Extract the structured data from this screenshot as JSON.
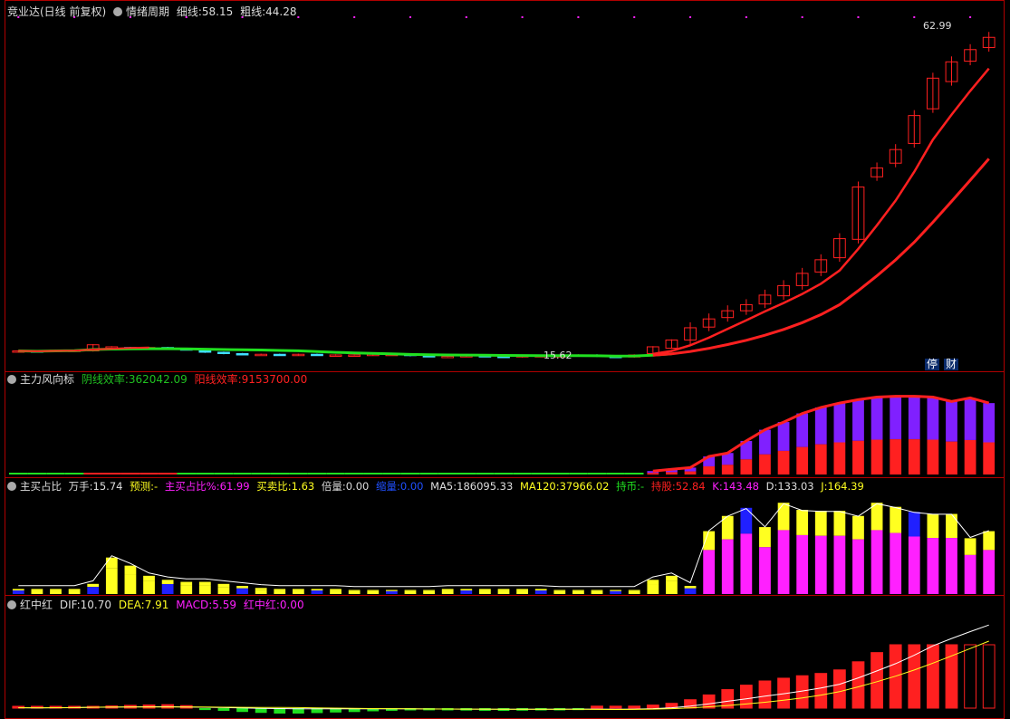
{
  "header": {
    "title": "竞业达(日线 前复权)",
    "indicator_name": "情绪周期",
    "thin_label": "细线:",
    "thin_value": "58.15",
    "thick_label": "粗线:",
    "thick_value": "44.28"
  },
  "price_panel": {
    "high_label": "62.99",
    "low_label": "15.62",
    "badge_1": "停",
    "badge_2": "财"
  },
  "panel2": {
    "name": "主力风向标",
    "yin_label": "阴线效率:",
    "yin_value": "362042.09",
    "yang_label": "阳线效率:",
    "yang_value": "9153700.00"
  },
  "panel3": {
    "name": "主买占比",
    "wanshou_label": "万手:",
    "wanshou_value": "15.74",
    "yuce_label": "预测:",
    "yuce_value": "-",
    "zmzb_label": "主买占比%:",
    "zmzb_value": "61.99",
    "mmb_label": "买卖比:",
    "mmb_value": "1.63",
    "beiliang_label": "倍量:",
    "beiliang_value": "0.00",
    "suoliang_label": "缩量:",
    "suoliang_value": "0.00",
    "ma5_label": "MA5:",
    "ma5_value": "186095.33",
    "ma120_label": "MA120:",
    "ma120_value": "37966.02",
    "chibi_label": "持币:",
    "chibi_value": "-",
    "chigu_label": "持股:",
    "chigu_value": "52.84",
    "k_label": "K:",
    "k_value": "143.48",
    "d_label": "D:",
    "d_value": "133.03",
    "j_label": "J:",
    "j_value": "164.39"
  },
  "panel4": {
    "name": "红中红",
    "dif_label": "DIF:",
    "dif_value": "10.70",
    "dea_label": "DEA:",
    "dea_value": "7.91",
    "macd_label": "MACD:",
    "macd_value": "5.59",
    "hzh_label": "红中红:",
    "hzh_value": "0.00"
  },
  "colors": {
    "up": "#ff2020",
    "down": "#40e0ff",
    "ma_thin": "#ff2020",
    "ma_green": "#20e020",
    "purple": "#8020ff",
    "magenta": "#ff20ff",
    "yellow": "#ffff20",
    "blue": "#2020ff"
  },
  "chart_data": [
    {
      "type": "candlestick",
      "series": "price",
      "x": [
        1,
        2,
        3,
        4,
        5,
        6,
        7,
        8,
        9,
        10,
        11,
        12,
        13,
        14,
        15,
        16,
        17,
        18,
        19,
        20,
        21,
        22,
        23,
        24,
        25,
        26,
        27,
        28,
        29,
        30,
        31,
        32,
        33,
        34,
        35,
        36,
        37,
        38,
        39,
        40,
        41,
        42,
        43,
        44,
        45,
        46,
        47,
        48,
        49,
        50
      ],
      "open": [
        16.3,
        16.4,
        16.3,
        16.5,
        16.4,
        17.0,
        16.9,
        16.8,
        16.9,
        16.7,
        16.5,
        16.2,
        16.0,
        15.9,
        15.9,
        15.8,
        15.9,
        15.8,
        15.8,
        15.8,
        15.9,
        15.9,
        15.7,
        15.6,
        15.6,
        15.7,
        15.6,
        15.5,
        15.7,
        15.7,
        15.7,
        15.8,
        15.6,
        15.5,
        16.0,
        16.8,
        18.0,
        19.9,
        21.3,
        22.3,
        23.3,
        24.5,
        26.0,
        28.0,
        30.1,
        32.8,
        42.0,
        44.0,
        46.9,
        52.0,
        56.0,
        59.0,
        61.0
      ],
      "close": [
        16.4,
        16.3,
        16.5,
        16.5,
        17.3,
        17.0,
        16.8,
        16.9,
        16.7,
        16.6,
        16.2,
        16.0,
        15.9,
        15.9,
        15.8,
        15.9,
        15.8,
        15.8,
        15.8,
        15.9,
        15.9,
        15.7,
        15.6,
        15.6,
        15.7,
        15.6,
        15.5,
        15.7,
        15.7,
        15.7,
        15.8,
        15.6,
        15.5,
        15.8,
        17.0,
        18.0,
        19.8,
        21.1,
        22.3,
        23.2,
        24.6,
        26.0,
        27.8,
        29.8,
        32.9,
        40.5,
        43.3,
        46.0,
        51.0,
        56.5,
        58.9,
        60.7,
        62.5
      ],
      "high_label": 62.99,
      "low_label": 15.62
    },
    {
      "type": "line",
      "series": "emotion_cycle",
      "names": [
        "细线",
        "粗线"
      ],
      "last_values": [
        58.15,
        44.28
      ]
    },
    {
      "type": "bar",
      "series": "主力风向标",
      "values": [
        0.01,
        0.01,
        0.01,
        0.02,
        0.02,
        0.02,
        0.02,
        0.02,
        0.02,
        0.02,
        0.02,
        0.02,
        0.02,
        0.02,
        0.02,
        0.01,
        0.01,
        0.01,
        0.01,
        0.01,
        0.01,
        0.01,
        0.01,
        0.01,
        0.01,
        0.01,
        0.01,
        0.01,
        0.01,
        0.01,
        0.01,
        0.01,
        0.01,
        0.01,
        0.04,
        0.06,
        0.08,
        0.21,
        0.25,
        0.39,
        0.52,
        0.61,
        0.71,
        0.78,
        0.83,
        0.87,
        0.9,
        0.91,
        0.91,
        0.9,
        0.85,
        0.89,
        0.83,
        0.73
      ]
    },
    {
      "type": "bar",
      "series": "主买占比",
      "values": [
        0.05,
        0.05,
        0.05,
        0.05,
        0.1,
        0.36,
        0.28,
        0.18,
        0.14,
        0.12,
        0.12,
        0.1,
        0.08,
        0.06,
        0.05,
        0.05,
        0.05,
        0.05,
        0.04,
        0.04,
        0.04,
        0.04,
        0.04,
        0.05,
        0.05,
        0.05,
        0.05,
        0.05,
        0.05,
        0.04,
        0.04,
        0.04,
        0.04,
        0.04,
        0.14,
        0.18,
        0.08,
        0.62,
        0.77,
        0.85,
        0.66,
        0.9,
        0.83,
        0.82,
        0.82,
        0.77,
        0.9,
        0.86,
        0.81,
        0.79,
        0.79,
        0.55,
        0.62
      ]
    },
    {
      "type": "bar",
      "series": "MACD",
      "dif_last": 10.7,
      "dea_last": 7.91,
      "macd_last": 5.59
    }
  ]
}
